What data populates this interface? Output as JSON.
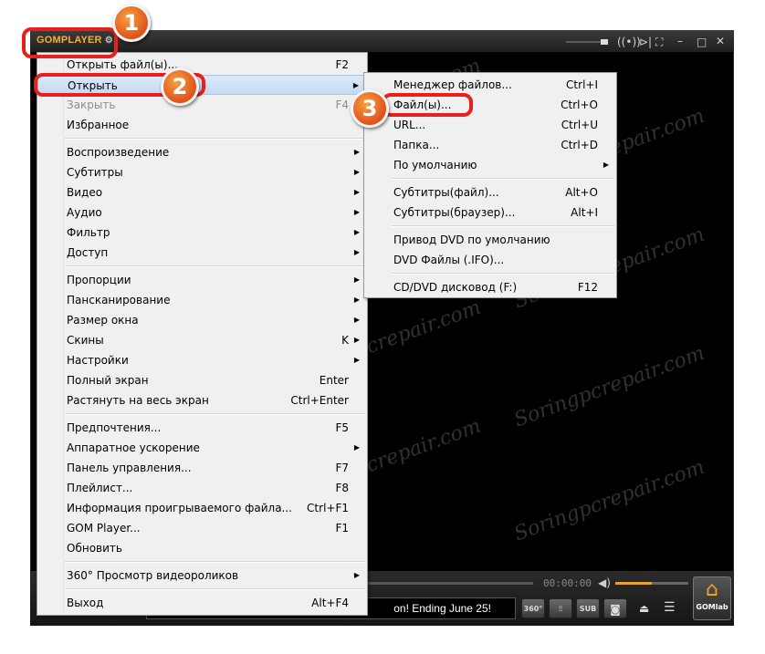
{
  "player": {
    "logo": "GOMPLAYER",
    "titlebar_controls": [
      "minimize",
      "maximize",
      "close"
    ],
    "time": "00:00:00",
    "ticker": "on! Ending June 25!",
    "buttons": {
      "btn360": "360°",
      "eq": "EQ",
      "sub": "SUB",
      "cap": "CAP"
    },
    "gomlab": "GOMlab"
  },
  "main_menu": {
    "items": [
      {
        "label": "Открыть файл(ы)...",
        "shortcut": "F2"
      },
      {
        "label": "Открыть",
        "shortcut": "",
        "submenu": true
      },
      {
        "label": "Закрыть",
        "shortcut": "F4",
        "disabled": true
      },
      {
        "label": "Избранное",
        "shortcut": ""
      },
      {
        "label": "Воспроизведение",
        "shortcut": "",
        "submenu": true
      },
      {
        "label": "Субтитры",
        "shortcut": "",
        "submenu": true
      },
      {
        "label": "Видео",
        "shortcut": "",
        "submenu": true
      },
      {
        "label": "Аудио",
        "shortcut": "",
        "submenu": true
      },
      {
        "label": "Фильтр",
        "shortcut": "",
        "submenu": true
      },
      {
        "label": "Доступ",
        "shortcut": "",
        "submenu": true
      },
      {
        "label": "Пропорции",
        "shortcut": "",
        "submenu": true
      },
      {
        "label": "Пансканирование",
        "shortcut": "",
        "submenu": true
      },
      {
        "label": "Размер окна",
        "shortcut": "",
        "submenu": true
      },
      {
        "label": "Скины",
        "shortcut": "K",
        "submenu": true
      },
      {
        "label": "Настройки",
        "shortcut": "",
        "submenu": true
      },
      {
        "label": "Полный экран",
        "shortcut": "Enter"
      },
      {
        "label": "Растянуть на весь экран",
        "shortcut": "Ctrl+Enter"
      },
      {
        "label": "Предпочтения...",
        "shortcut": "F5"
      },
      {
        "label": "Аппаратное ускорение",
        "shortcut": "",
        "submenu": true
      },
      {
        "label": "Панель управления...",
        "shortcut": "F7"
      },
      {
        "label": "Плейлист...",
        "shortcut": "F8"
      },
      {
        "label": "Информация проигрываемого файла...",
        "shortcut": "Ctrl+F1"
      },
      {
        "label": "GOM Player...",
        "shortcut": "F1"
      },
      {
        "label": "Обновить",
        "shortcut": ""
      },
      {
        "label": "360° Просмотр видеороликов",
        "shortcut": "",
        "submenu": true
      },
      {
        "label": "Выход",
        "shortcut": "Alt+F4"
      }
    ]
  },
  "open_submenu": {
    "items": [
      {
        "label": "Менеджер файлов...",
        "shortcut": "Ctrl+I"
      },
      {
        "label": "Файл(ы)...",
        "shortcut": "Ctrl+O"
      },
      {
        "label": "URL...",
        "shortcut": "Ctrl+U"
      },
      {
        "label": "Папка...",
        "shortcut": "Ctrl+D"
      },
      {
        "label": "По умолчанию",
        "shortcut": "",
        "submenu": true
      },
      {
        "label": "Субтитры(файл)...",
        "shortcut": "Alt+O"
      },
      {
        "label": "Субтитры(браузер)...",
        "shortcut": "Alt+I"
      },
      {
        "label": "Привод DVD по умолчанию",
        "shortcut": ""
      },
      {
        "label": "DVD Файлы (.IFO)...",
        "shortcut": ""
      },
      {
        "label": "CD/DVD дисковод (F:)",
        "shortcut": "F12"
      }
    ]
  },
  "annotations": {
    "step1": "1",
    "step2": "2",
    "step3": "3",
    "accent": "#e8201b"
  },
  "watermark": "Soringpcrepair.com"
}
